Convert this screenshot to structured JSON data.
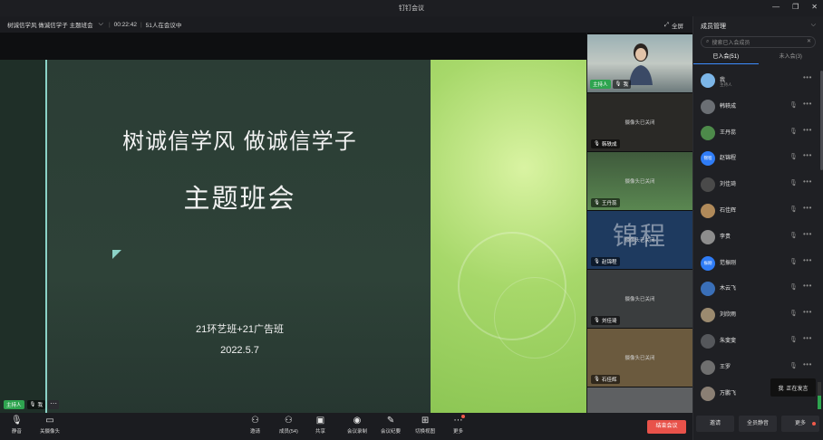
{
  "window": {
    "title": "钉钉会议"
  },
  "meeting": {
    "name": "树诚信学风 做诚信学子  主题班会",
    "duration": "00:22:42",
    "count": "51人在会议中",
    "fullscreen_label": "全屏"
  },
  "slide": {
    "title1": "树诚信学风  做诚信学子",
    "title2": "主题班会",
    "classes": "21环艺班+21广告班",
    "date": "2022.5.7"
  },
  "host_bar": {
    "host_badge": "主持人",
    "me": "我"
  },
  "video_tiles": [
    {
      "name": "我",
      "host_badge": "主持人",
      "camera_off": ""
    },
    {
      "name": "韩轶成",
      "camera_off": "摄像头已关闭"
    },
    {
      "name": "王丹蕊",
      "camera_off": "摄像头已关闭"
    },
    {
      "name": "赵锦程",
      "camera_off": "摄像头已关闭",
      "overlay": "锦程"
    },
    {
      "name": "刘佳琦",
      "camera_off": "摄像头已关闭"
    },
    {
      "name": "石佳辉",
      "camera_off": "摄像头已关闭"
    }
  ],
  "toolbar": {
    "mute": "静音",
    "camera": "关摄像头",
    "invite": "邀请",
    "members": "成员(54)",
    "share": "共享",
    "record": "会议录制",
    "minutes": "会议纪要",
    "view": "切换视图",
    "more": "更多",
    "end": "结束会议"
  },
  "panel": {
    "title": "成员管理",
    "search_placeholder": "搜索已入会成员",
    "tab_joined": "已入会(51)",
    "tab_not_joined": "未入会(3)",
    "members": [
      {
        "name": "我",
        "sub": "主持人",
        "avatar": "",
        "color": "#7cb6e8"
      },
      {
        "name": "韩轶成",
        "sub": "",
        "avatar": "",
        "color": "#6b6f74"
      },
      {
        "name": "王丹蕊",
        "sub": "",
        "avatar": "",
        "color": "#4d8a4a"
      },
      {
        "name": "赵锦程",
        "sub": "",
        "avatar": "锦程",
        "color": "#2f7cf6"
      },
      {
        "name": "刘佳琦",
        "sub": "",
        "avatar": "",
        "color": "#4a4a4a"
      },
      {
        "name": "石佳辉",
        "sub": "",
        "avatar": "",
        "color": "#b08a5a"
      },
      {
        "name": "李贵",
        "sub": "",
        "avatar": "",
        "color": "#8d8d8d"
      },
      {
        "name": "范振刚",
        "sub": "",
        "avatar": "振刚",
        "color": "#2f7cf6"
      },
      {
        "name": "木云飞",
        "sub": "",
        "avatar": "",
        "color": "#3a6fb8"
      },
      {
        "name": "刘欣雨",
        "sub": "",
        "avatar": "",
        "color": "#9b8a6f"
      },
      {
        "name": "朱斐斐",
        "sub": "",
        "avatar": "",
        "color": "#55575b"
      },
      {
        "name": "王罗",
        "sub": "",
        "avatar": "",
        "color": "#6f6f6f"
      },
      {
        "name": "万鹏飞",
        "sub": "",
        "avatar": "",
        "color": "#8a7f74"
      }
    ],
    "speaking_me": "我",
    "speaking_label": "正在发言",
    "footer_invite": "邀请",
    "footer_mute_all": "全员静音",
    "footer_more": "更多"
  }
}
